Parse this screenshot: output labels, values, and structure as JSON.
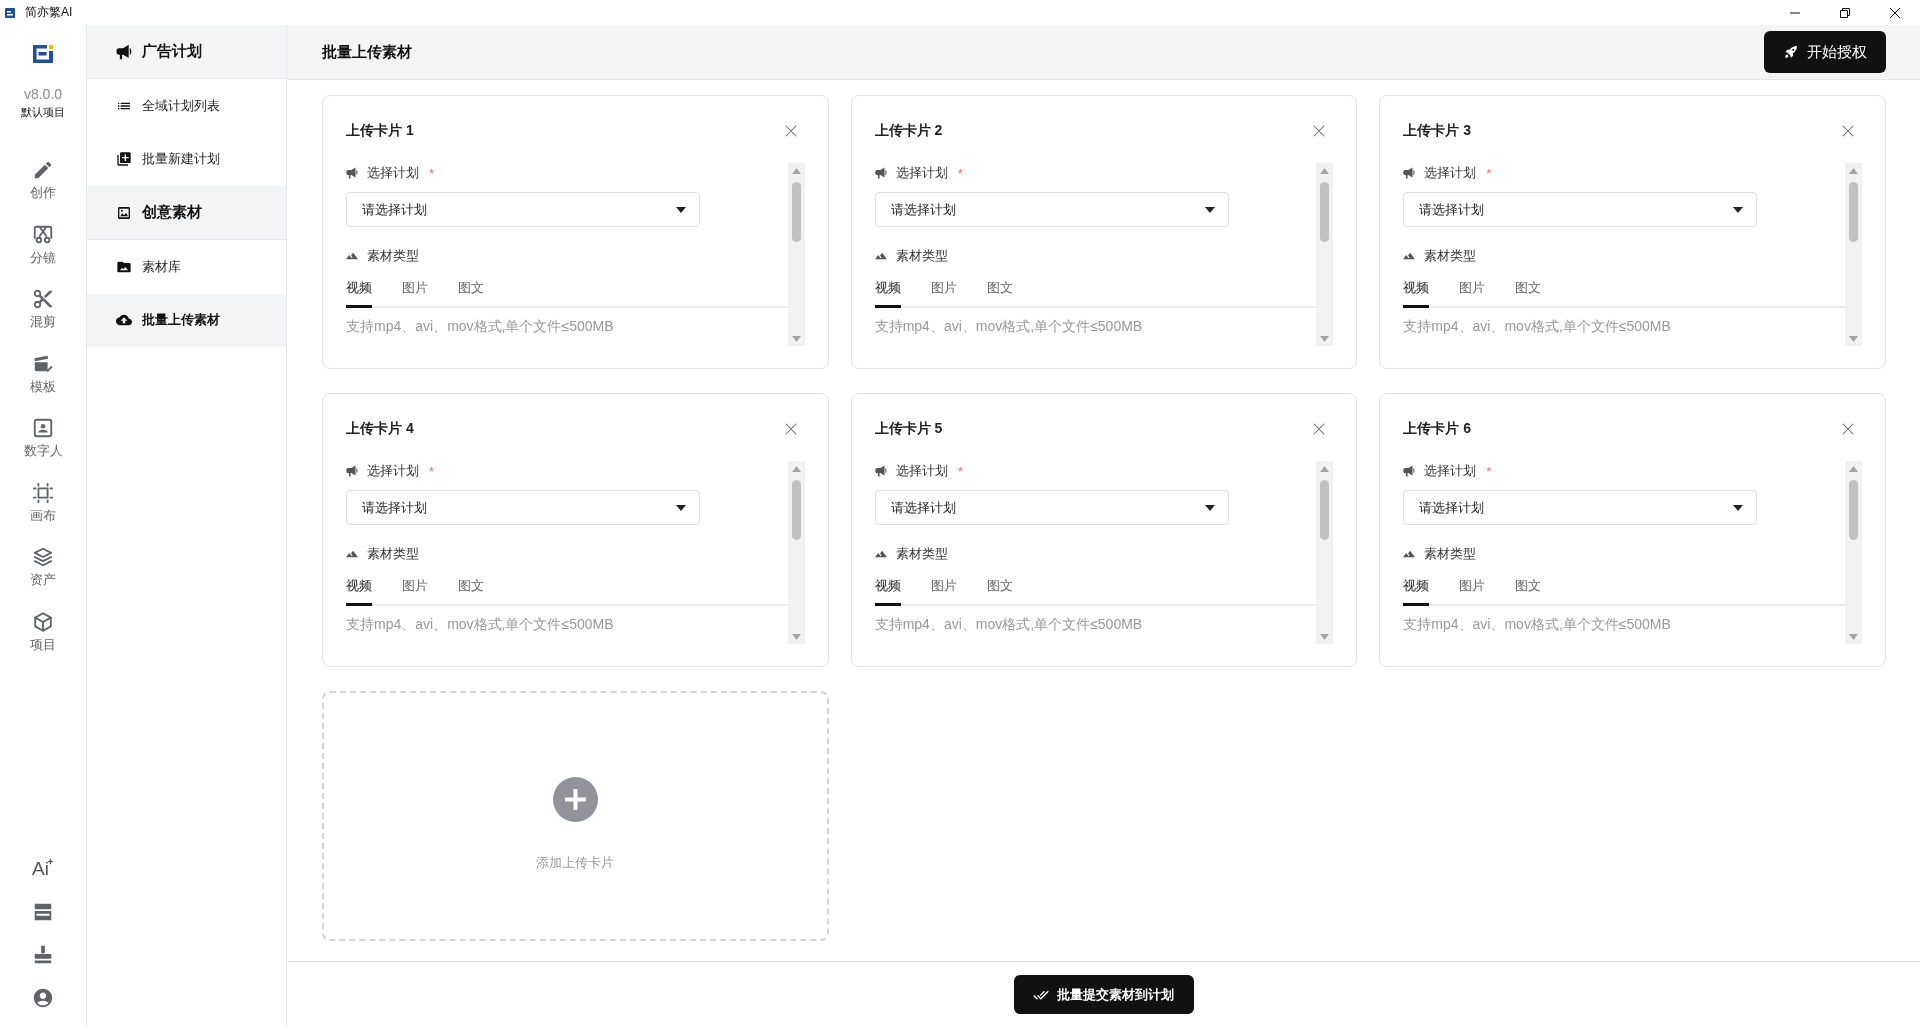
{
  "window": {
    "title": "简亦繁AI"
  },
  "rail": {
    "version": "v8.0.0",
    "project": "默认项目",
    "items": [
      {
        "label": "创作"
      },
      {
        "label": "分镜"
      },
      {
        "label": "混剪"
      },
      {
        "label": "模板"
      },
      {
        "label": "数字人"
      },
      {
        "label": "画布"
      },
      {
        "label": "资产"
      },
      {
        "label": "项目"
      }
    ],
    "ai_button": "Ai"
  },
  "sidebar": {
    "groups": [
      {
        "label": "广告计划",
        "children": [
          {
            "label": "全域计划列表",
            "selected": false
          },
          {
            "label": "批量新建计划",
            "selected": false
          }
        ]
      },
      {
        "label": "创意素材",
        "children": [
          {
            "label": "素材库",
            "selected": false
          },
          {
            "label": "批量上传素材",
            "selected": true
          }
        ]
      }
    ]
  },
  "header": {
    "title": "批量上传素材",
    "auth_button": "开始授权"
  },
  "cards": [
    {
      "title": "上传卡片 1",
      "plan_label": "选择计划",
      "required_mark": "*",
      "plan_select": {
        "placeholder": "请选择计划"
      },
      "type_label": "素材类型",
      "tabs": [
        {
          "label": "视频",
          "selected": true
        },
        {
          "label": "图片",
          "selected": false
        },
        {
          "label": "图文",
          "selected": false
        }
      ],
      "hint": "支持mp4、avi、mov格式,单个文件≤500MB"
    },
    {
      "title": "上传卡片 2",
      "plan_label": "选择计划",
      "required_mark": "*",
      "plan_select": {
        "placeholder": "请选择计划"
      },
      "type_label": "素材类型",
      "tabs": [
        {
          "label": "视频",
          "selected": true
        },
        {
          "label": "图片",
          "selected": false
        },
        {
          "label": "图文",
          "selected": false
        }
      ],
      "hint": "支持mp4、avi、mov格式,单个文件≤500MB"
    },
    {
      "title": "上传卡片 3",
      "plan_label": "选择计划",
      "required_mark": "*",
      "plan_select": {
        "placeholder": "请选择计划"
      },
      "type_label": "素材类型",
      "tabs": [
        {
          "label": "视频",
          "selected": true
        },
        {
          "label": "图片",
          "selected": false
        },
        {
          "label": "图文",
          "selected": false
        }
      ],
      "hint": "支持mp4、avi、mov格式,单个文件≤500MB"
    },
    {
      "title": "上传卡片 4",
      "plan_label": "选择计划",
      "required_mark": "*",
      "plan_select": {
        "placeholder": "请选择计划"
      },
      "type_label": "素材类型",
      "tabs": [
        {
          "label": "视频",
          "selected": true
        },
        {
          "label": "图片",
          "selected": false
        },
        {
          "label": "图文",
          "selected": false
        }
      ],
      "hint": "支持mp4、avi、mov格式,单个文件≤500MB"
    },
    {
      "title": "上传卡片 5",
      "plan_label": "选择计划",
      "required_mark": "*",
      "plan_select": {
        "placeholder": "请选择计划"
      },
      "type_label": "素材类型",
      "tabs": [
        {
          "label": "视频",
          "selected": true
        },
        {
          "label": "图片",
          "selected": false
        },
        {
          "label": "图文",
          "selected": false
        }
      ],
      "hint": "支持mp4、avi、mov格式,单个文件≤500MB"
    },
    {
      "title": "上传卡片 6",
      "plan_label": "选择计划",
      "required_mark": "*",
      "plan_select": {
        "placeholder": "请选择计划"
      },
      "type_label": "素材类型",
      "tabs": [
        {
          "label": "视频",
          "selected": true
        },
        {
          "label": "图片",
          "selected": false
        },
        {
          "label": "图文",
          "selected": false
        }
      ],
      "hint": "支持mp4、avi、mov格式,单个文件≤500MB"
    }
  ],
  "add_card": {
    "label": "添加上传卡片"
  },
  "footer": {
    "submit_button": "批量提交素材到计划"
  }
}
